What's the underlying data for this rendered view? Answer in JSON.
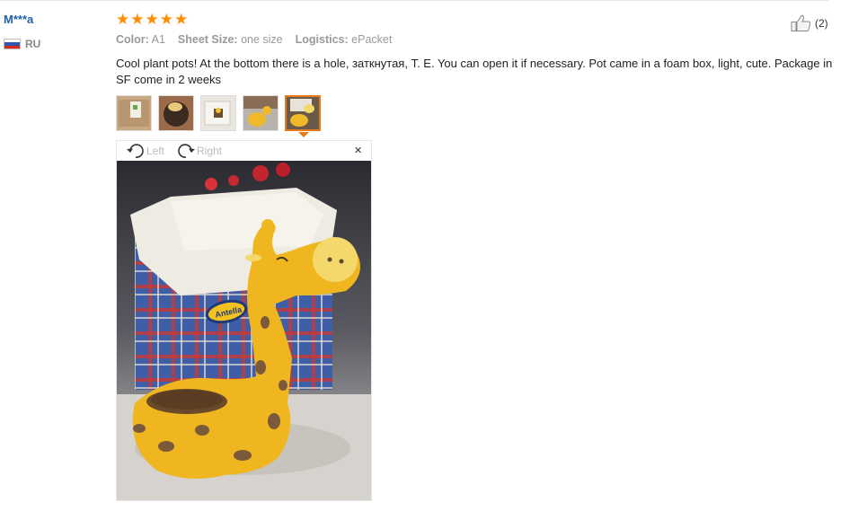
{
  "review": {
    "user": {
      "name": "M***a",
      "country_code": "RU",
      "flag_icon": "russia-flag-icon"
    },
    "rating_stars": 5,
    "helpful": {
      "count_label": "(2)",
      "icon": "thumbs-up-icon"
    },
    "attributes": [
      {
        "key": "Color:",
        "value": "A1"
      },
      {
        "key": "Sheet Size:",
        "value": "one size"
      },
      {
        "key": "Logistics:",
        "value": "ePacket"
      }
    ],
    "text": "Cool plant pots! At the bottom there is a hole, заткнутая, T. E. You can open it if necessary. Pot came in a foam box, light, cute. Package in SF come in 2 weeks",
    "thumbnails": 5,
    "active_thumbnail": 5
  },
  "viewer": {
    "rotate_left_label": "Left",
    "rotate_right_label": "Right",
    "close_label": "×",
    "photo_brand_text": "Antella"
  },
  "colors": {
    "accent": "#e87a1e",
    "star": "#ff8b00",
    "username": "#1f62a8"
  }
}
